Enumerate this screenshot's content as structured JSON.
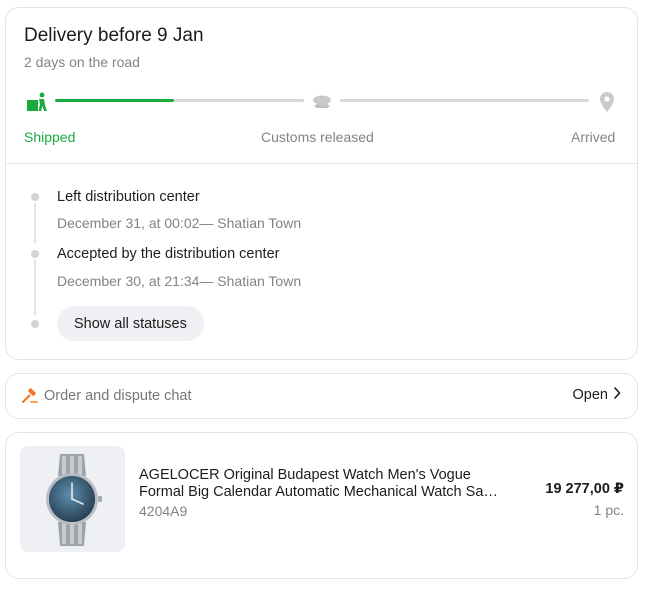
{
  "delivery": {
    "title": "Delivery before 9 Jan",
    "subtitle": "2 days on the road",
    "progress_fraction": 0.25,
    "stages": [
      {
        "label": "Shipped",
        "icon": "shipped-box-icon",
        "active": true
      },
      {
        "label": "Customs released",
        "icon": "customs-cap-icon",
        "active": false
      },
      {
        "label": "Arrived",
        "icon": "location-pin-icon",
        "active": false
      }
    ],
    "events": [
      {
        "title": "Left distribution center",
        "detail": "December 31, at 00:02— Shatian Town"
      },
      {
        "title": "Accepted by the distribution center",
        "detail": "December 30, at 21:34— Shatian Town"
      }
    ],
    "show_all_label": "Show all statuses"
  },
  "chat": {
    "icon": "gavel-icon",
    "label": "Order and dispute chat",
    "open_label": "Open",
    "open_icon": "chevron-right-icon"
  },
  "product": {
    "name_line1": "AGELOCER Original Budapest Watch Men's Vogue",
    "name_line2": "Formal Big Calendar Automatic Mechanical Watch Sapphire",
    "sku": "4204A9",
    "price": "19 277,00 ₽",
    "quantity": "1 pc.",
    "image": "wristwatch-image"
  },
  "colors": {
    "accent_green": "#1aab3e",
    "muted_text": "#808389",
    "track_gray": "#d6d7da",
    "chat_icon_orange": "#f07a2a"
  }
}
